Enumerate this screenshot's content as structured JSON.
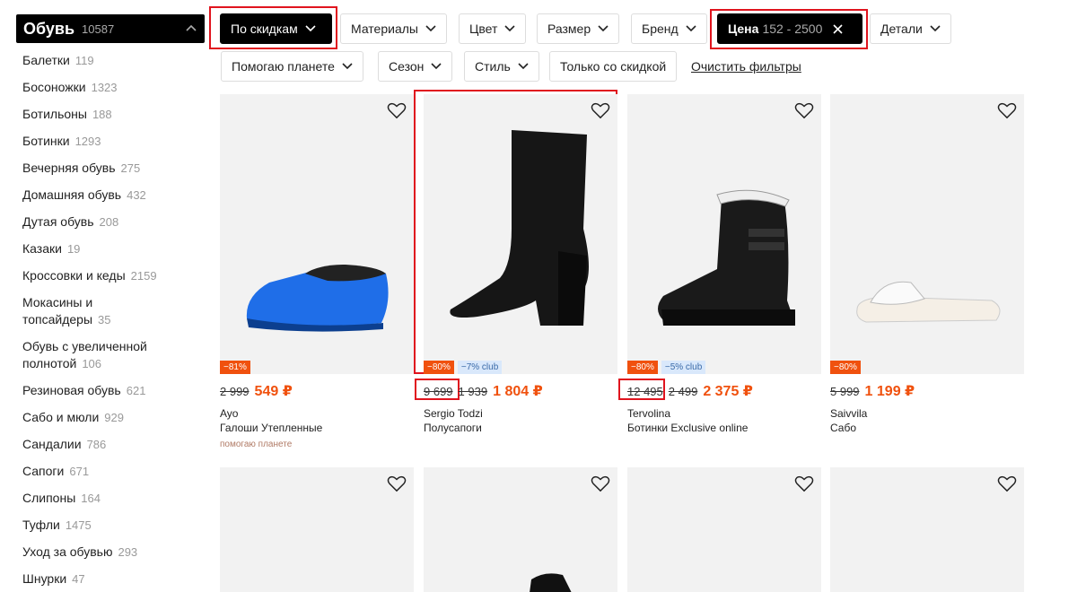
{
  "sidebar": {
    "header": {
      "title": "Обувь",
      "count": "10587"
    },
    "items": [
      {
        "label": "Балетки",
        "count": "119"
      },
      {
        "label": "Босоножки",
        "count": "1323"
      },
      {
        "label": "Ботильоны",
        "count": "188"
      },
      {
        "label": "Ботинки",
        "count": "1293"
      },
      {
        "label": "Вечерняя обувь",
        "count": "275"
      },
      {
        "label": "Домашняя обувь",
        "count": "432"
      },
      {
        "label": "Дутая обувь",
        "count": "208"
      },
      {
        "label": "Казаки",
        "count": "19"
      },
      {
        "label": "Кроссовки и кеды",
        "count": "2159"
      },
      {
        "label": "Мокасины и топсайдеры",
        "count": "35"
      },
      {
        "label": "Обувь с увеличенной полнотой",
        "count": "106"
      },
      {
        "label": "Резиновая обувь",
        "count": "621"
      },
      {
        "label": "Сабо и мюли",
        "count": "929"
      },
      {
        "label": "Сандалии",
        "count": "786"
      },
      {
        "label": "Сапоги",
        "count": "671"
      },
      {
        "label": "Слипоны",
        "count": "164"
      },
      {
        "label": "Туфли",
        "count": "1475"
      },
      {
        "label": "Уход за обувью",
        "count": "293"
      },
      {
        "label": "Шнурки",
        "count": "47"
      }
    ]
  },
  "filters": {
    "sort": "По скидкам",
    "materials": "Материалы",
    "color": "Цвет",
    "size": "Размер",
    "brand": "Бренд",
    "price_label": "Цена",
    "price_range": "152 - 2500",
    "details": "Детали",
    "planet": "Помогаю планете",
    "season": "Сезон",
    "style": "Стиль",
    "discount_only": "Только со скидкой",
    "clear": "Очистить фильтры"
  },
  "products": [
    {
      "discount": "−81%",
      "club": "",
      "old_price": "2 999",
      "old_price2": "",
      "price": "549 ₽",
      "brand": "Ayo",
      "name": "Галоши Утепленные",
      "tag": "помогаю планете"
    },
    {
      "discount": "−80%",
      "club": "−7% club",
      "old_price": "9 699",
      "old_price2": "1 939",
      "price": "1 804 ₽",
      "brand": "Sergio Todzi",
      "name": "Полусапоги",
      "tag": ""
    },
    {
      "discount": "−80%",
      "club": "−5% club",
      "old_price": "12 495",
      "old_price2": "2 499",
      "price": "2 375 ₽",
      "brand": "Tervolina",
      "name": "Ботинки Exclusive online",
      "tag": ""
    },
    {
      "discount": "−80%",
      "club": "",
      "old_price": "5 999",
      "old_price2": "",
      "price": "1 199 ₽",
      "brand": "Saivvila",
      "name": "Сабо",
      "tag": ""
    }
  ],
  "colors": {
    "accent": "#f0510e",
    "highlight": "#e0141e",
    "dark": "#000000"
  }
}
